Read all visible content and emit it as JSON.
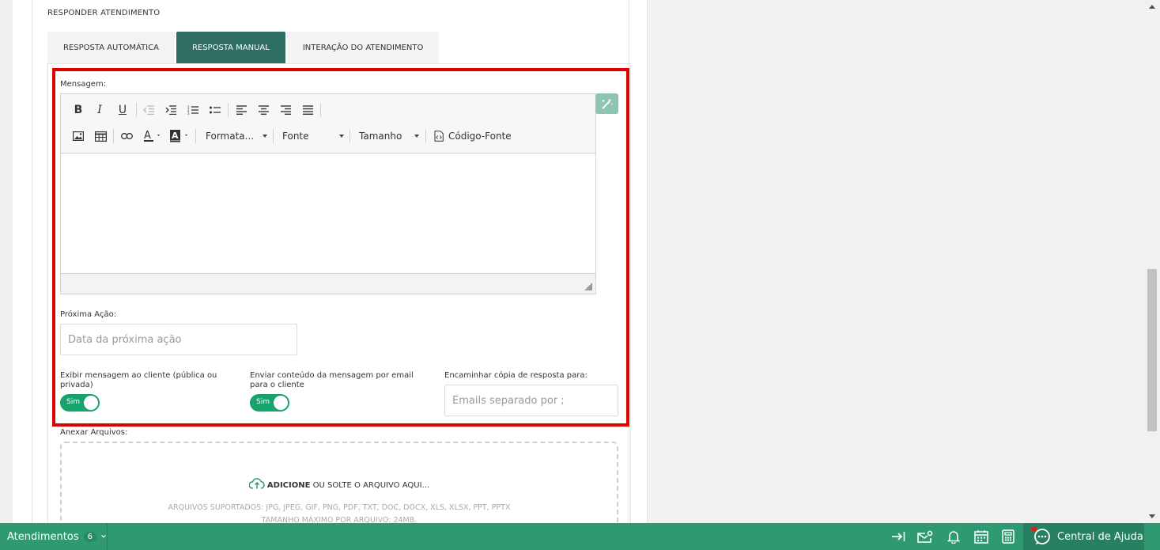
{
  "section_title": "RESPONDER ATENDIMENTO",
  "tabs": [
    {
      "label": "RESPOSTA AUTOMÁTICA",
      "active": false
    },
    {
      "label": "RESPOSTA MANUAL",
      "active": true
    },
    {
      "label": "INTERAÇÃO DO ATENDIMENTO",
      "active": false
    }
  ],
  "message": {
    "label": "Mensagem:",
    "toolbar": {
      "format_label": "Formata...",
      "font_label": "Fonte",
      "size_label": "Tamanho",
      "source_label": "Código-Fonte"
    }
  },
  "next_action": {
    "label": "Próxima Ação:",
    "placeholder": "Data da próxima ação"
  },
  "show_message": {
    "label": "Exibir mensagem ao cliente (pública ou privada)",
    "toggle_label": "Sim"
  },
  "send_email": {
    "label": "Enviar conteúdo da mensagem por email para o cliente",
    "toggle_label": "Sim"
  },
  "forward_copy": {
    "label": "Encaminhar cópia de resposta para:",
    "placeholder": "Emails separado por ;"
  },
  "attachments": {
    "label": "Anexar Arquivos:",
    "add_text": "ADICIONE",
    "drop_text": "OU SOLTE O ARQUIVO AQUI...",
    "supported": "ARQUIVOS SUPORTADOS: JPG, JPEG, GIF, PNG, PDF, TXT, DOC, DOCX, XLS, XLSX, PPT, PPTX",
    "max_size": "TAMANHO MÁXIMO POR ARQUIVO: 24MB."
  },
  "footer": {
    "atendimentos_label": "Atendimentos",
    "atendimentos_count": "6",
    "help_label": "Central de Ajuda"
  },
  "colors": {
    "accent": "#2e6e63",
    "footer": "#2f9a72",
    "highlight": "#e00000",
    "toggle": "#17a36d"
  }
}
